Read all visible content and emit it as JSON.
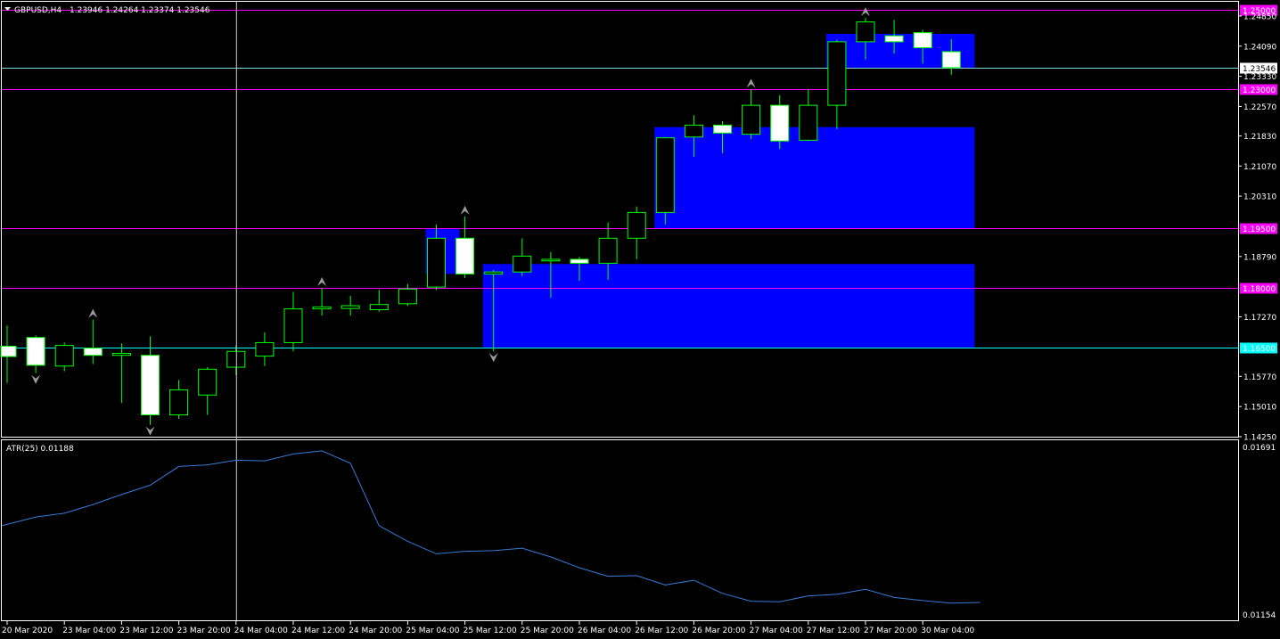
{
  "header": {
    "symbol": "GBPUSD,H4",
    "ohlc": "1.23946 1.24264 1.23374 1.23546"
  },
  "indicator": {
    "label": "ATR(25) 0.01188",
    "scale_max": "0.01691",
    "scale_min": "0.01154"
  },
  "colors": {
    "background": "#000000",
    "frame": "#ffffff",
    "bull_candle_border": "#00ff00",
    "bull_candle_body": "#000000",
    "bear_candle_body": "#ffffff",
    "zone_fill": "#0000ff",
    "level_line": "#ff00ff",
    "bid_line": "#7fd8d8",
    "support_line": "#00ffff",
    "atr_line": "#3a7bd5",
    "fractal": "#9a9a9a"
  },
  "chart_data": {
    "type": "candlestick",
    "symbol": "GBPUSD",
    "timeframe": "H4",
    "price_axis": {
      "min": 1.1425,
      "max": 1.2523,
      "ticks": [
        "1.24850",
        "1.24090",
        "1.23330",
        "1.22570",
        "1.21830",
        "1.21070",
        "1.20310",
        "1.18790",
        "1.17270",
        "1.15770",
        "1.15010",
        "1.14250"
      ]
    },
    "time_labels": [
      {
        "i": 0,
        "t": "20 Mar 2020"
      },
      {
        "i": 2,
        "t": "23 Mar 04:00"
      },
      {
        "i": 4,
        "t": "23 Mar 12:00"
      },
      {
        "i": 6,
        "t": "23 Mar 20:00"
      },
      {
        "i": 8,
        "t": "24 Mar 04:00"
      },
      {
        "i": 10,
        "t": "24 Mar 12:00"
      },
      {
        "i": 12,
        "t": "24 Mar 20:00"
      },
      {
        "i": 14,
        "t": "25 Mar 04:00"
      },
      {
        "i": 16,
        "t": "25 Mar 12:00"
      },
      {
        "i": 18,
        "t": "25 Mar 20:00"
      },
      {
        "i": 20,
        "t": "26 Mar 04:00"
      },
      {
        "i": 22,
        "t": "26 Mar 12:00"
      },
      {
        "i": 24,
        "t": "26 Mar 20:00"
      },
      {
        "i": 26,
        "t": "27 Mar 04:00"
      },
      {
        "i": 28,
        "t": "27 Mar 12:00"
      },
      {
        "i": 30,
        "t": "27 Mar 20:00"
      },
      {
        "i": 32,
        "t": "30 Mar 04:00"
      }
    ],
    "candles": [
      {
        "o": 1.1653,
        "h": 1.1705,
        "l": 1.156,
        "c": 1.1627
      },
      {
        "o": 1.1675,
        "h": 1.168,
        "l": 1.1585,
        "c": 1.1605
      },
      {
        "o": 1.1603,
        "h": 1.1662,
        "l": 1.159,
        "c": 1.1655
      },
      {
        "o": 1.1648,
        "h": 1.172,
        "l": 1.1608,
        "c": 1.163
      },
      {
        "o": 1.163,
        "h": 1.166,
        "l": 1.151,
        "c": 1.1635
      },
      {
        "o": 1.163,
        "h": 1.1678,
        "l": 1.1455,
        "c": 1.148
      },
      {
        "o": 1.148,
        "h": 1.1568,
        "l": 1.147,
        "c": 1.1543
      },
      {
        "o": 1.153,
        "h": 1.16,
        "l": 1.148,
        "c": 1.1595
      },
      {
        "o": 1.16,
        "h": 1.1655,
        "l": 1.158,
        "c": 1.164
      },
      {
        "o": 1.1628,
        "h": 1.1688,
        "l": 1.1603,
        "c": 1.1662
      },
      {
        "o": 1.1662,
        "h": 1.179,
        "l": 1.164,
        "c": 1.1747
      },
      {
        "o": 1.1747,
        "h": 1.18,
        "l": 1.173,
        "c": 1.1752
      },
      {
        "o": 1.1748,
        "h": 1.178,
        "l": 1.173,
        "c": 1.1755
      },
      {
        "o": 1.1745,
        "h": 1.1795,
        "l": 1.174,
        "c": 1.1758
      },
      {
        "o": 1.176,
        "h": 1.181,
        "l": 1.1755,
        "c": 1.1797
      },
      {
        "o": 1.1802,
        "h": 1.196,
        "l": 1.1795,
        "c": 1.1925
      },
      {
        "o": 1.1925,
        "h": 1.198,
        "l": 1.1825,
        "c": 1.1835
      },
      {
        "o": 1.1835,
        "h": 1.1845,
        "l": 1.164,
        "c": 1.184
      },
      {
        "o": 1.184,
        "h": 1.1925,
        "l": 1.183,
        "c": 1.188
      },
      {
        "o": 1.1868,
        "h": 1.189,
        "l": 1.1775,
        "c": 1.1872
      },
      {
        "o": 1.1872,
        "h": 1.1878,
        "l": 1.1818,
        "c": 1.1862
      },
      {
        "o": 1.1862,
        "h": 1.1965,
        "l": 1.182,
        "c": 1.1925
      },
      {
        "o": 1.1925,
        "h": 1.2005,
        "l": 1.1872,
        "c": 1.199
      },
      {
        "o": 1.199,
        "h": 1.218,
        "l": 1.196,
        "c": 1.2178
      },
      {
        "o": 1.218,
        "h": 1.2235,
        "l": 1.213,
        "c": 1.221
      },
      {
        "o": 1.221,
        "h": 1.222,
        "l": 1.214,
        "c": 1.219
      },
      {
        "o": 1.2187,
        "h": 1.23,
        "l": 1.2175,
        "c": 1.226
      },
      {
        "o": 1.226,
        "h": 1.2285,
        "l": 1.215,
        "c": 1.217
      },
      {
        "o": 1.2172,
        "h": 1.23,
        "l": 1.217,
        "c": 1.226
      },
      {
        "o": 1.226,
        "h": 1.2425,
        "l": 1.22,
        "c": 1.242
      },
      {
        "o": 1.242,
        "h": 1.248,
        "l": 1.2375,
        "c": 1.247
      },
      {
        "o": 1.2435,
        "h": 1.2475,
        "l": 1.239,
        "c": 1.242
      },
      {
        "o": 1.2443,
        "h": 1.245,
        "l": 1.2365,
        "c": 1.2405
      },
      {
        "o": 1.2395,
        "h": 1.2426,
        "l": 1.2337,
        "c": 1.2355
      }
    ],
    "fractals": [
      {
        "i": 3,
        "type": "up",
        "price": 1.172
      },
      {
        "i": 1,
        "type": "down",
        "price": 1.1585
      },
      {
        "i": 5,
        "type": "down",
        "price": 1.1455
      },
      {
        "i": 11,
        "type": "up",
        "price": 1.18
      },
      {
        "i": 16,
        "type": "up",
        "price": 1.198
      },
      {
        "i": 17,
        "type": "down",
        "price": 1.164
      },
      {
        "i": 26,
        "type": "up",
        "price": 1.23
      },
      {
        "i": 30,
        "type": "up",
        "price": 1.248
      }
    ],
    "zones": [
      {
        "i_from": 15,
        "i_to": 16,
        "price_top": 1.195,
        "price_bottom": 1.1835
      },
      {
        "i_from": 17,
        "i_to": 34,
        "price_top": 1.186,
        "price_bottom": 1.165
      },
      {
        "i_from": 23,
        "i_to": 34,
        "price_top": 1.2205,
        "price_bottom": 1.195
      },
      {
        "i_from": 29,
        "i_to": 34,
        "price_top": 1.244,
        "price_bottom": 1.2355
      }
    ],
    "levels": [
      {
        "price": 1.25,
        "label": "1.25000",
        "kind": "resistance"
      },
      {
        "price": 1.23,
        "label": "1.23000",
        "kind": "resistance"
      },
      {
        "price": 1.195,
        "label": "1.19500",
        "kind": "resistance"
      },
      {
        "price": 1.18,
        "label": "1.18000",
        "kind": "resistance"
      },
      {
        "price": 1.165,
        "label": "1.16500",
        "kind": "support"
      }
    ],
    "bid": {
      "price": 1.23546,
      "label": "1.23546"
    },
    "crosshair_index": 8,
    "atr": {
      "period": 25,
      "range": [
        0.01154,
        0.01691
      ],
      "values": [
        0.0144,
        0.01468,
        0.0148,
        0.01508,
        0.0154,
        0.0157,
        0.0163,
        0.01635,
        0.0165,
        0.01648,
        0.0167,
        0.0168,
        0.0164,
        0.0144,
        0.0139,
        0.0135,
        0.01358,
        0.0136,
        0.01368,
        0.0134,
        0.01305,
        0.01278,
        0.0128,
        0.0125,
        0.01265,
        0.01223,
        0.01198,
        0.01196,
        0.01215,
        0.0122,
        0.01236,
        0.0121,
        0.012,
        0.01192,
        0.01194
      ]
    }
  }
}
